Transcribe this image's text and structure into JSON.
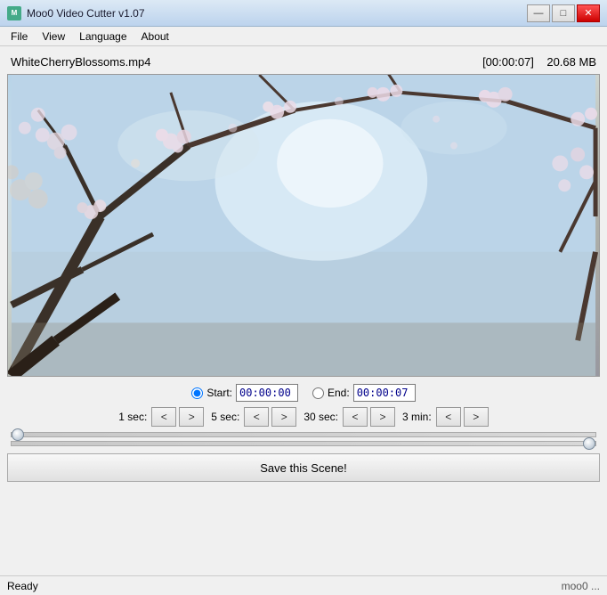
{
  "titleBar": {
    "title": "Moo0 Video Cutter v1.07",
    "icon": "M",
    "minimizeLabel": "—",
    "maximizeLabel": "□",
    "closeLabel": "✕"
  },
  "menuBar": {
    "items": [
      "File",
      "View",
      "Language",
      "About"
    ]
  },
  "fileInfo": {
    "filename": "WhiteCherryBlossoms.mp4",
    "duration": "[00:00:07]",
    "filesize": "20.68 MB"
  },
  "timeControls": {
    "startLabel": "Start:",
    "startValue": "00:00:00",
    "endLabel": "End:",
    "endValue": "00:00:07"
  },
  "stepControls": [
    {
      "label": "1 sec:",
      "back": "<",
      "forward": ">"
    },
    {
      "label": "5 sec:",
      "back": "<",
      "forward": ">"
    },
    {
      "label": "30 sec:",
      "back": "<",
      "forward": ">"
    },
    {
      "label": "3 min:",
      "back": "<",
      "forward": ">"
    }
  ],
  "saveButton": {
    "label": "Save this Scene!"
  },
  "statusBar": {
    "status": "Ready",
    "link": "moo0 ..."
  },
  "slider1": {
    "value": 0
  },
  "slider2": {
    "value": 100
  }
}
